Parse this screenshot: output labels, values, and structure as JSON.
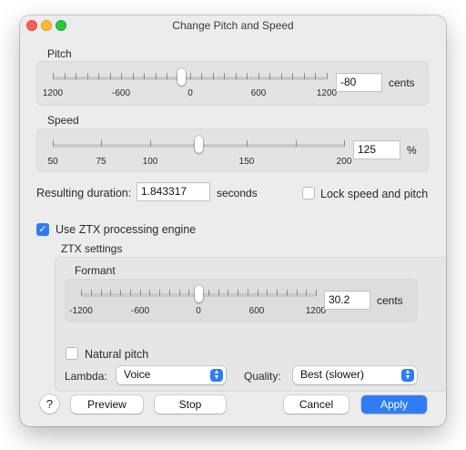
{
  "window": {
    "title": "Change Pitch and Speed"
  },
  "pitch": {
    "label": "Pitch",
    "scale": [
      "1200",
      "-600",
      "0",
      "600",
      "1200"
    ],
    "value": "-80",
    "unit": "cents"
  },
  "speed": {
    "label": "Speed",
    "scale": [
      "50",
      "75",
      "100",
      "150",
      "200"
    ],
    "value": "125",
    "unit": "%"
  },
  "duration": {
    "label": "Resulting duration:",
    "value": "1.843317",
    "unit": "seconds"
  },
  "lock": {
    "label": "Lock speed and pitch",
    "checked": false
  },
  "ztx": {
    "checkbox_label": "Use ZTX processing engine",
    "checked": true,
    "settings_label": "ZTX settings",
    "formant": {
      "label": "Formant",
      "scale": [
        "-1200",
        "-600",
        "0",
        "600",
        "1200"
      ],
      "value": "30.2",
      "unit": "cents"
    },
    "natural_pitch": {
      "label": "Natural pitch",
      "checked": false
    },
    "lambda": {
      "label": "Lambda:",
      "selected": "Voice"
    },
    "quality": {
      "label": "Quality:",
      "selected": "Best (slower)"
    }
  },
  "buttons": {
    "help": "?",
    "preview": "Preview",
    "stop": "Stop",
    "cancel": "Cancel",
    "apply": "Apply"
  },
  "colors": {
    "accent": "#2f7cf6"
  }
}
